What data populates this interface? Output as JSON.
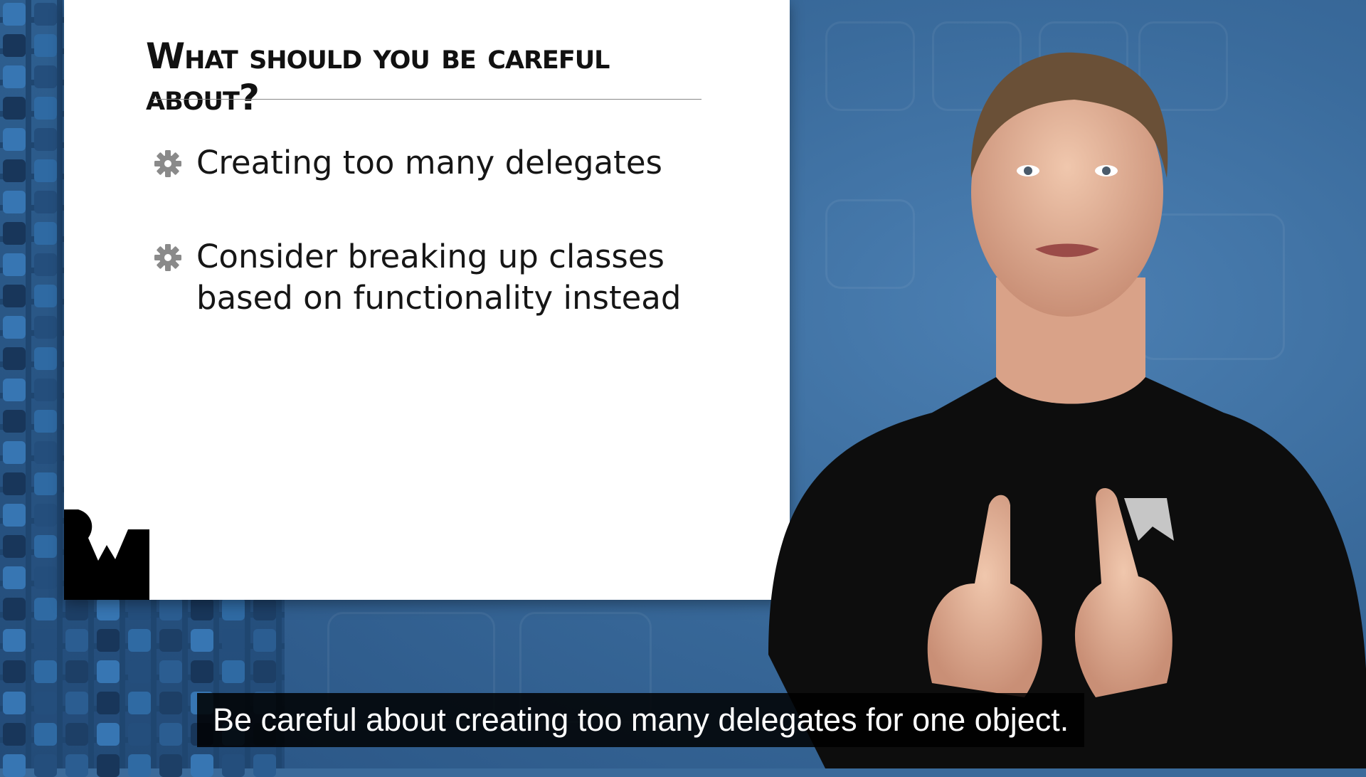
{
  "slide": {
    "title": "What should you be careful about?",
    "bullets": [
      {
        "icon": "gear-icon",
        "text": "Creating too many delegates"
      },
      {
        "icon": "gear-icon",
        "text": "Consider breaking up classes based on functionality instead"
      }
    ],
    "logo": "raywenderlich-logo"
  },
  "video": {
    "caption": "Be careful about creating too many delegates for one object."
  },
  "colors": {
    "background_blue": "#3a6a9a",
    "slide_background": "#ffffff",
    "caption_background": "#000000",
    "caption_text": "#ffffff",
    "bullet_icon": "#8a8a8a"
  }
}
